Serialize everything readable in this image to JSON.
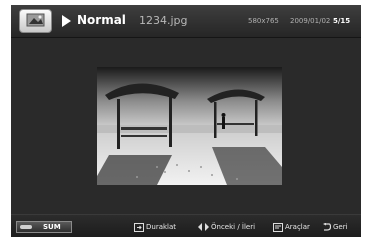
{
  "header": {
    "mode": "Normal",
    "filename": "1234.jpg",
    "resolution": "580x765",
    "date": "2009/01/02",
    "page": "5/15"
  },
  "footer": {
    "sum_label": "SUM",
    "pause_label": "Duraklat",
    "prevnext_label": "Önceki / İleri",
    "tools_label": "Araçlar",
    "back_label": "Geri"
  },
  "icons": [
    "photo-app-icon",
    "play-icon",
    "pause-icon",
    "prev-next-icon",
    "tools-icon",
    "return-icon"
  ]
}
